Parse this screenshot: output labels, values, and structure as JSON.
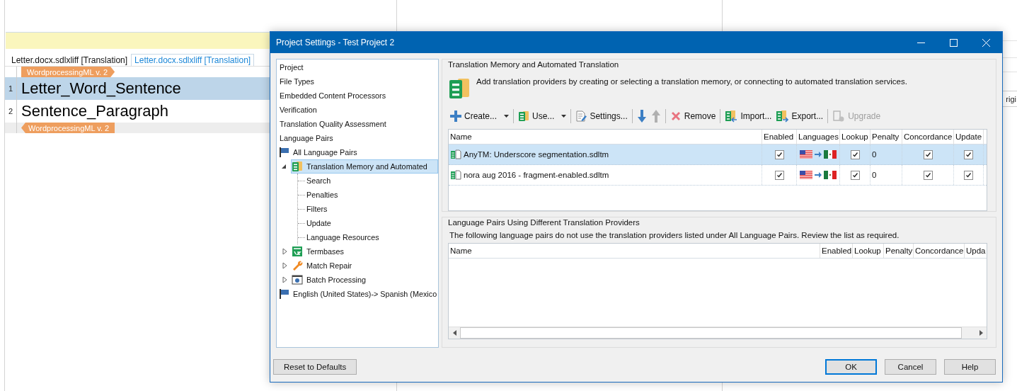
{
  "editor": {
    "tabs": [
      {
        "label": "Letter.docx.sdlxliff [Translation]",
        "selected": false
      },
      {
        "label": "Letter.docx.sdlxliff [Translation]",
        "selected": true
      }
    ],
    "rows": [
      {
        "kind": "tag-open",
        "label": "WordprocessingML v. 2"
      },
      {
        "kind": "segment",
        "number": "1",
        "text": "Letter_Word_Sentence",
        "selected": true
      },
      {
        "kind": "segment",
        "number": "2",
        "text": "Sentence_Paragraph",
        "selected": false
      },
      {
        "kind": "tag-close",
        "label": "WordprocessingML v. 2"
      }
    ]
  },
  "side_panel": {
    "column_header": "rigi"
  },
  "dialog": {
    "title": "Project Settings - Test Project 2",
    "tree": [
      {
        "label": "Project",
        "selected": false
      },
      {
        "label": "File Types",
        "selected": false
      },
      {
        "label": "Embedded Content Processors",
        "selected": false
      },
      {
        "label": "Verification",
        "selected": false
      },
      {
        "label": "Translation Quality Assessment",
        "selected": false
      },
      {
        "label": "Language Pairs",
        "selected": false
      },
      {
        "label": "All Language Pairs",
        "kind": "flag",
        "selected": false,
        "children": [
          {
            "label": "Translation Memory and Automated",
            "kind": "tm",
            "expanded": true,
            "selected": true,
            "children": [
              {
                "label": "Search",
                "selected": false
              },
              {
                "label": "Penalties",
                "selected": false
              },
              {
                "label": "Filters",
                "selected": false
              },
              {
                "label": "Update",
                "selected": false
              },
              {
                "label": "Language Resources",
                "selected": false
              }
            ]
          },
          {
            "label": "Termbases",
            "kind": "termbase",
            "expanded": false,
            "selected": false
          },
          {
            "label": "Match Repair",
            "kind": "wrench",
            "expanded": false,
            "selected": false
          },
          {
            "label": "Batch Processing",
            "kind": "batch",
            "expanded": false,
            "selected": false
          }
        ]
      },
      {
        "label": "English (United States)-> Spanish (Mexico",
        "kind": "flag",
        "selected": false
      }
    ],
    "tm_group": {
      "title": "Translation Memory and Automated Translation",
      "description": "Add translation providers by creating or selecting a translation memory, or connecting to automated translation services.",
      "toolbar": [
        {
          "kind": "create",
          "label": "Create...",
          "dropdown": true,
          "disabled": false
        },
        {
          "kind": "separator"
        },
        {
          "kind": "use",
          "label": "Use...",
          "dropdown": true,
          "disabled": false
        },
        {
          "kind": "separator"
        },
        {
          "kind": "settings",
          "label": "Settings...",
          "dropdown": false,
          "disabled": false
        },
        {
          "kind": "separator"
        },
        {
          "kind": "move-down",
          "dropdown": false,
          "disabled": false
        },
        {
          "kind": "move-up",
          "dropdown": false,
          "disabled": true
        },
        {
          "kind": "separator"
        },
        {
          "kind": "remove",
          "label": "Remove",
          "dropdown": false,
          "disabled": false
        },
        {
          "kind": "separator"
        },
        {
          "kind": "import",
          "label": "Import...",
          "dropdown": false,
          "disabled": false
        },
        {
          "kind": "export",
          "label": "Export...",
          "dropdown": false,
          "disabled": false
        },
        {
          "kind": "separator"
        },
        {
          "kind": "upgrade",
          "label": "Upgrade",
          "dropdown": false,
          "disabled": true
        }
      ],
      "columns": [
        "Name",
        "Enabled",
        "Languages",
        "Lookup",
        "Penalty",
        "Concordance",
        "Update"
      ],
      "rows": [
        {
          "name": "AnyTM: Underscore segmentation.sdltm",
          "enabled": true,
          "lookup": true,
          "penalty": "0",
          "concordance": true,
          "update": true,
          "selected": true
        },
        {
          "name": "nora aug 2016 - fragment-enabled.sdltm",
          "enabled": true,
          "lookup": true,
          "penalty": "0",
          "concordance": true,
          "update": true,
          "selected": false
        }
      ]
    },
    "other_group": {
      "title": "Language Pairs Using Different Translation Providers",
      "description": "The following language pairs do not use the translation providers listed under All Language Pairs. Review the list as required.",
      "columns": [
        "Name",
        "Enabled",
        "Lookup",
        "Penalty",
        "Concordance",
        "Upda"
      ]
    },
    "reset_button": {
      "label": "Reset to Defaults"
    },
    "buttons": [
      {
        "label": "OK",
        "default": true
      },
      {
        "label": "Cancel",
        "default": false
      },
      {
        "label": "Help",
        "default": false
      }
    ]
  }
}
